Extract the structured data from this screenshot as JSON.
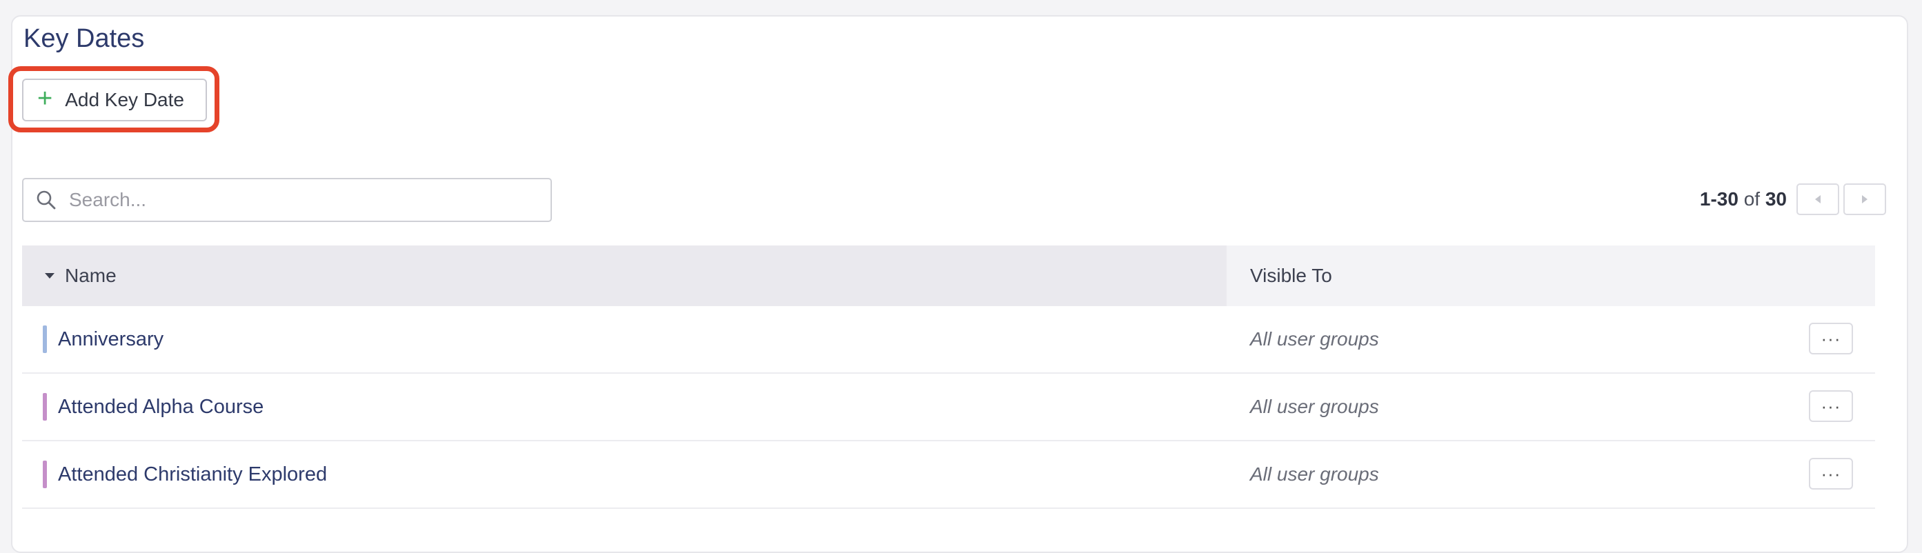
{
  "page": {
    "title": "Key Dates"
  },
  "toolbar": {
    "add_label": "Add Key Date",
    "add_icon": "plus-icon",
    "highlight_color": "#e5432a"
  },
  "search": {
    "placeholder": "Search...",
    "value": ""
  },
  "pagination": {
    "range": "1-30",
    "of_label": "of",
    "total": "30"
  },
  "table": {
    "columns": {
      "name": "Name",
      "visible_to": "Visible To"
    },
    "sort": {
      "column": "name",
      "direction": "descending-arrow"
    },
    "rows": [
      {
        "name": "Anniversary",
        "visible_to": "All user groups",
        "color": "#9fb8e0",
        "menu": "···"
      },
      {
        "name": "Attended Alpha Course",
        "visible_to": "All user groups",
        "color": "#c58fc9",
        "menu": "···"
      },
      {
        "name": "Attended Christianity Explored",
        "visible_to": "All user groups",
        "color": "#c58fc9",
        "menu": "···"
      }
    ]
  },
  "colors": {
    "accent_plus": "#3fae5c",
    "title_text": "#2d3a6b",
    "header_bg": "#eae9ee"
  }
}
